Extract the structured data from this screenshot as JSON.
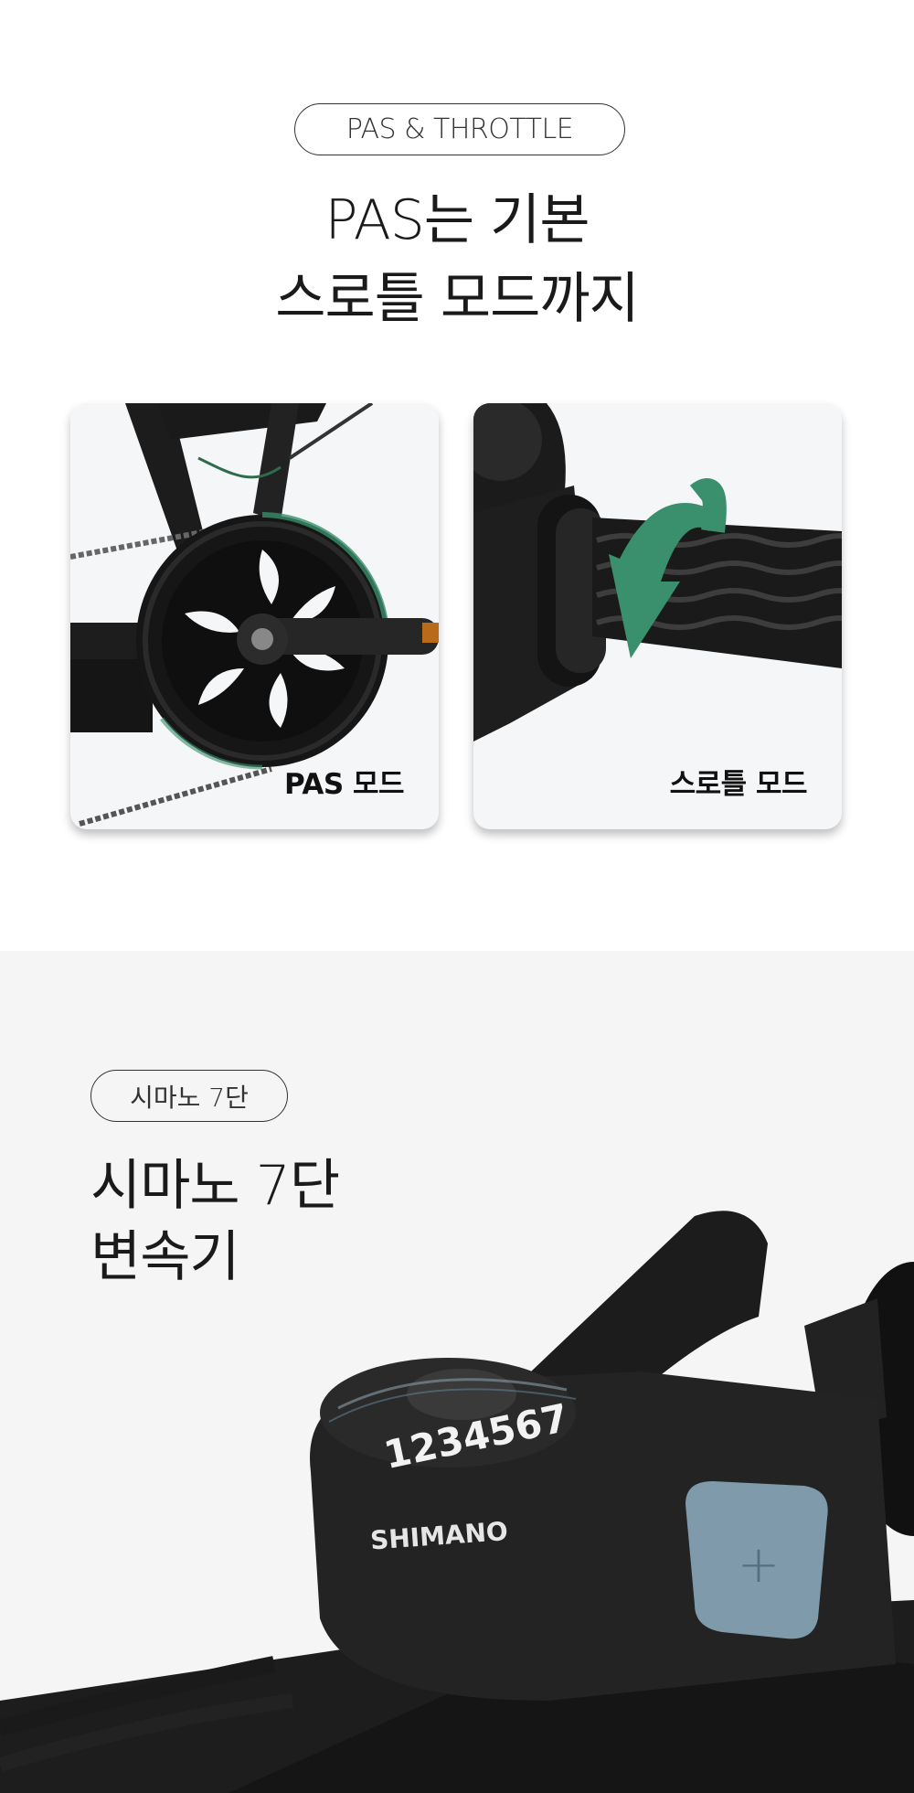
{
  "section_throttle": {
    "badge": "PAS & THROTTLE",
    "headline_line1": "PAS는 기본",
    "headline_line2": "스로틀 모드까지",
    "cards": [
      {
        "label": "PAS 모드",
        "accent": "#1f6b4c"
      },
      {
        "label": "스로틀 모드",
        "accent": "#3a8f6c"
      }
    ]
  },
  "section_shifter": {
    "badge": "시마노 7단",
    "headline_line1": "시마노 7단",
    "headline_line2": "변속기",
    "shifter": {
      "brand": "SHIMANO",
      "gear_numbers": "1234567",
      "button_symbol": "+"
    }
  },
  "colors": {
    "accent_green": "#3a8f6c",
    "shifter_button": "#7f9bab",
    "page_bg_top": "#ffffff",
    "page_bg_bottom": "#f5f5f5"
  }
}
